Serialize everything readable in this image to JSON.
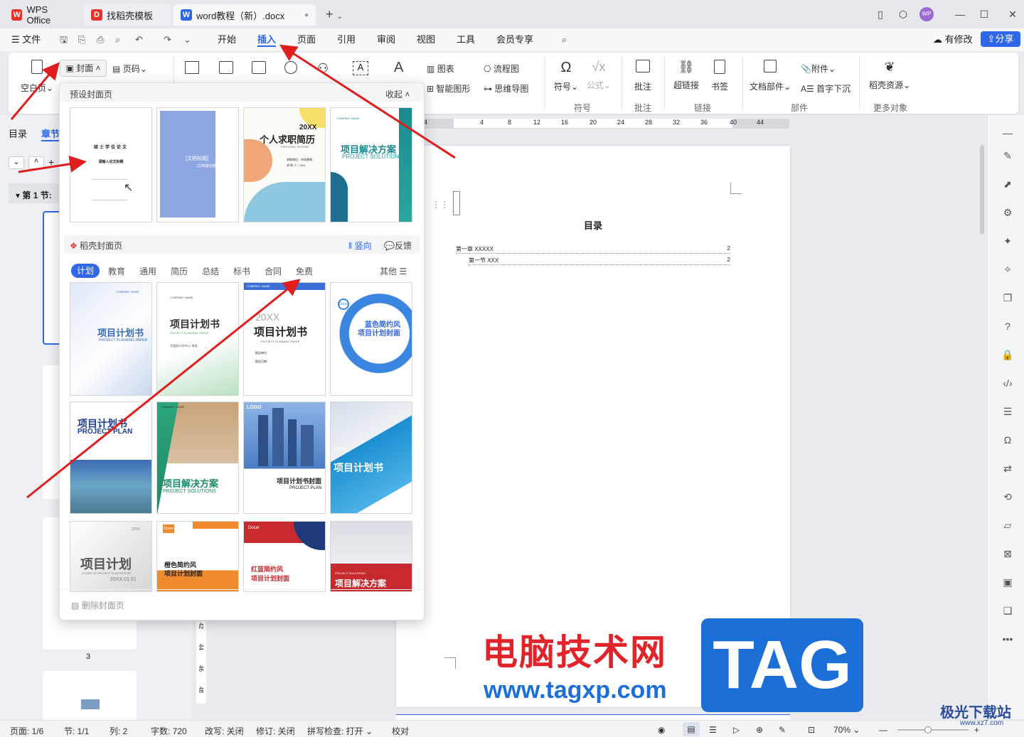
{
  "titlebar": {
    "tabs": [
      {
        "label": "WPS Office"
      },
      {
        "label": "找稻壳模板"
      },
      {
        "label": "word教程（新）.docx"
      }
    ],
    "new_tab": "+",
    "avatar": "WP"
  },
  "menubar": {
    "file": "文件",
    "items": [
      "开始",
      "插入",
      "页面",
      "引用",
      "审阅",
      "视图",
      "工具",
      "会员专享"
    ],
    "active": "插入",
    "modified": "有修改",
    "share": "分享"
  },
  "ribbon": {
    "blank_page": "空白页",
    "cover": "封面",
    "page_number": "页码",
    "chart": "图表",
    "flowchart": "流程图",
    "smart_graphic": "智能图形",
    "mindmap": "思维导图",
    "symbol": "符号",
    "formula": "公式",
    "comment": "批注",
    "hyperlink": "超链接",
    "bookmark": "书签",
    "doc_parts": "文档部件",
    "attachment": "附件",
    "drop_cap": "首字下沉",
    "docer_resources": "稻壳资源",
    "groups": {
      "symbol": "符号",
      "comment": "批注",
      "link": "链接",
      "parts": "部件",
      "more": "更多对象"
    }
  },
  "leftpanel": {
    "tab_toc": "目录",
    "tab_chapter": "章节",
    "section": "第 1 节:",
    "page_label": "3"
  },
  "ruler": [
    "4",
    "4",
    "8",
    "12",
    "16",
    "20",
    "24",
    "28",
    "32",
    "36",
    "40",
    "44"
  ],
  "vruler": [
    "42",
    "44",
    "46",
    "48"
  ],
  "document": {
    "toc_title": "目录",
    "toc_lines": [
      {
        "text": "第一章 XXXXX",
        "page": "2"
      },
      {
        "text": "第一节 XXX",
        "page": "2"
      }
    ]
  },
  "dropdown": {
    "preset_title": "预设封面页",
    "collapse": "收起",
    "preset_cards": [
      {
        "lines": [
          "硕士学位论文",
          "请输入论文标题"
        ]
      },
      {
        "title": "[文档标题]",
        "subtitle": "[文档副标题]"
      },
      {
        "title": "20XX",
        "subtitle": "个人求职简历",
        "en": "PERSONAL RESUME",
        "info": [
          "求职岗位：市场营销",
          "求 职 人：XXX"
        ]
      },
      {
        "brand": "COMPANY NAME",
        "title": "项目解决方案",
        "en": "PROJECT SOLUTIONS"
      }
    ],
    "docer_title": "稻壳封面页",
    "vertical": "竖向",
    "feedback": "反馈",
    "categories": [
      "计划",
      "教育",
      "通用",
      "简历",
      "总结",
      "标书",
      "合同",
      "免费"
    ],
    "active_category": "计划",
    "others": "其他",
    "template_cards": [
      {
        "brand": "COMPANY NAME",
        "title": "项目计划书",
        "en": "PROJECT PLANNING PAPER"
      },
      {
        "brand": "COMPANY NAME",
        "title": "项目计划书",
        "en": "PROJECT PLANNING PAPER",
        "sub": "早盘部计划书Q1 审批"
      },
      {
        "brand": "COMPANY NAME",
        "year": "20XX",
        "title": "项目计划书",
        "en": "PROJECT PLANNING PAPER",
        "fields": [
          "报告单位：",
          "报告日期："
        ]
      },
      {
        "logo": "Docer",
        "title": "蓝色简约风",
        "subtitle": "项目计划封面"
      },
      {
        "title": "项目计划书",
        "en": "PROJECT PLAN"
      },
      {
        "brand": "COMPANY NAME",
        "title": "项目解决方案",
        "en": "PROJECT SOLUTIONS"
      },
      {
        "logo": "LOGO",
        "title": "项目计划书封面",
        "en": "PROJECT PLAN"
      },
      {
        "logo": "LOGO",
        "title": "项目计划书"
      },
      {
        "year": "20XX",
        "title": "项目计划",
        "en": "COVER OF PROJECT PLAN REPORT",
        "date": "20XX.01.01"
      },
      {
        "logo": "Docer",
        "title": "橙色简约风",
        "subtitle": "项目计划封面"
      },
      {
        "logo": "Docer",
        "title": "红蓝简约风",
        "subtitle": "项目计划封面"
      },
      {
        "en": "PROJECT SOLUTIONS",
        "title": "项目解决方案"
      }
    ],
    "delete_cover": "删除封面页"
  },
  "statusbar": {
    "page": "页面: 1/6",
    "section": "节: 1/1",
    "column": "列: 2",
    "wordcount": "字数: 720",
    "track_changes": "改写: 关闭",
    "revision": "修订: 关闭",
    "spellcheck": "拼写检查: 打开",
    "proofread": "校对",
    "zoom": "70%"
  },
  "watermark": {
    "cn": "电脑技术网",
    "url": "www.tagxp.com",
    "tag": "TAG",
    "site2": "极光下载站",
    "site2_url": "www.xz7.com"
  },
  "colors": {
    "accent": "#2f67e8",
    "arrow": "#e01e1e",
    "watermark_red": "#e0242a",
    "watermark_blue": "#1b6fd6"
  }
}
